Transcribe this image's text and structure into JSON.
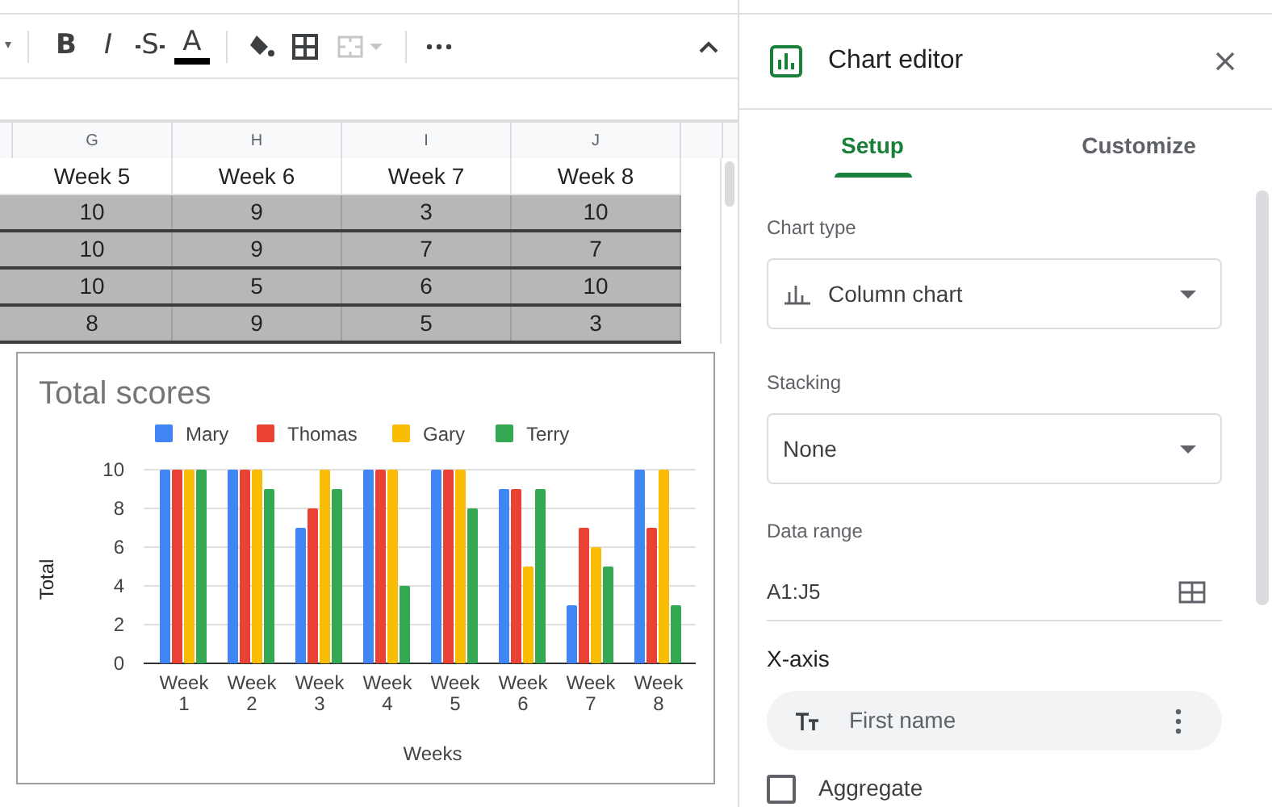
{
  "toolbar": {
    "format_buttons": [
      "B",
      "I",
      "S",
      "A"
    ],
    "merge": {
      "disabled": true
    }
  },
  "sheet": {
    "columns": [
      "G",
      "H",
      "I",
      "J"
    ],
    "rows": [
      {
        "shaded": false,
        "cells": [
          "Week 5",
          "Week 6",
          "Week 7",
          "Week 8"
        ]
      },
      {
        "shaded": true,
        "cells": [
          "10",
          "9",
          "3",
          "10"
        ]
      },
      {
        "shaded": true,
        "cells": [
          "10",
          "9",
          "7",
          "7"
        ]
      },
      {
        "shaded": true,
        "cells": [
          "10",
          "5",
          "6",
          "10"
        ]
      },
      {
        "shaded": true,
        "cells": [
          "8",
          "9",
          "5",
          "3"
        ]
      }
    ]
  },
  "chart": {
    "chart_data": {
      "type": "bar",
      "title": "Total scores",
      "xlabel": "Weeks",
      "ylabel": "Total",
      "categories": [
        "Week 1",
        "Week 2",
        "Week 3",
        "Week 4",
        "Week 5",
        "Week 6",
        "Week 7",
        "Week 8"
      ],
      "series": [
        {
          "name": "Mary",
          "color": "#4285f4",
          "values": [
            10,
            10,
            7,
            10,
            10,
            9,
            3,
            10
          ]
        },
        {
          "name": "Thomas",
          "color": "#ea4335",
          "values": [
            10,
            10,
            8,
            10,
            10,
            9,
            7,
            7
          ]
        },
        {
          "name": "Gary",
          "color": "#fbbc04",
          "values": [
            10,
            10,
            10,
            10,
            10,
            5,
            6,
            10
          ]
        },
        {
          "name": "Terry",
          "color": "#34a853",
          "values": [
            10,
            9,
            9,
            4,
            8,
            9,
            5,
            3
          ]
        }
      ],
      "ylim": [
        0,
        10
      ],
      "yticks": [
        {
          "value": 0,
          "label": "0"
        },
        {
          "value": 2,
          "label": "2"
        },
        {
          "value": 4,
          "label": "4"
        },
        {
          "value": 6,
          "label": "6"
        },
        {
          "value": 8,
          "label": "8"
        },
        {
          "value": 10,
          "label": "10"
        }
      ],
      "grid": true,
      "legend": true
    }
  },
  "editor": {
    "title": "Chart editor",
    "tabs": [
      {
        "label": "Setup",
        "selected": true
      },
      {
        "label": "Customize",
        "selected": false
      }
    ],
    "chart_type": {
      "label": "Chart type",
      "value": "Column chart"
    },
    "stacking": {
      "label": "Stacking",
      "value": "None"
    },
    "data_range": {
      "label": "Data range",
      "value": "A1:J5"
    },
    "x_axis": {
      "heading": "X-axis",
      "chip": "First name"
    },
    "aggregate": {
      "label": "Aggregate",
      "checked": false
    }
  }
}
